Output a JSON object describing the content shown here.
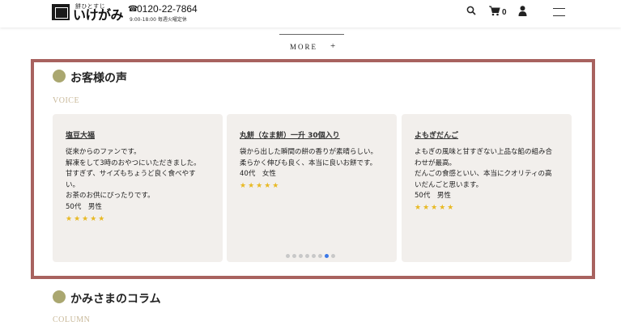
{
  "header": {
    "logo_small": "餅ひとすじ",
    "logo_main": "いけがみ",
    "tel_number": "0120-22-7864",
    "tel_hours": "9:00-18:00  毎週火曜定休",
    "cart_count": "0"
  },
  "more": {
    "label": "MORE",
    "plus": "+"
  },
  "voice": {
    "title": "お客様の声",
    "subtitle": "VOICE",
    "cards": [
      {
        "title": "塩豆大福",
        "body": "従来からのファンです。\n解凍をして3時のおやつにいただきました。\n甘すぎず、サイズもちょうど良く食べやす\nい。\nお茶のお供にぴったりです。\n50代　男性",
        "stars": "★★★★★"
      },
      {
        "title": "丸餅（なま餅）一升 30個入り",
        "body": "袋から出した瞬間の餅の香りが素晴らしい。\n柔らかく伸びも良く、本当に良いお餅です。\n40代　女性",
        "stars": "★★★★★"
      },
      {
        "title": "よもぎだんご",
        "body": "よもぎの風味と甘すぎない上品な餡の組み合\nわせが最高。\nだんごの食感といい、本当にクオリティの高\nいだんごと思います。\n50代　男性",
        "stars": "★★★★★"
      }
    ],
    "carousel": {
      "count": 8,
      "active_index": 6
    }
  },
  "column": {
    "title": "かみさまのコラム",
    "subtitle": "COLUMN"
  },
  "colors": {
    "frame": "#a8625f",
    "accent_dot": "#aaa770",
    "star": "#e8b923",
    "card_bg": "#f2efec",
    "active_dot": "#3b78e7"
  }
}
